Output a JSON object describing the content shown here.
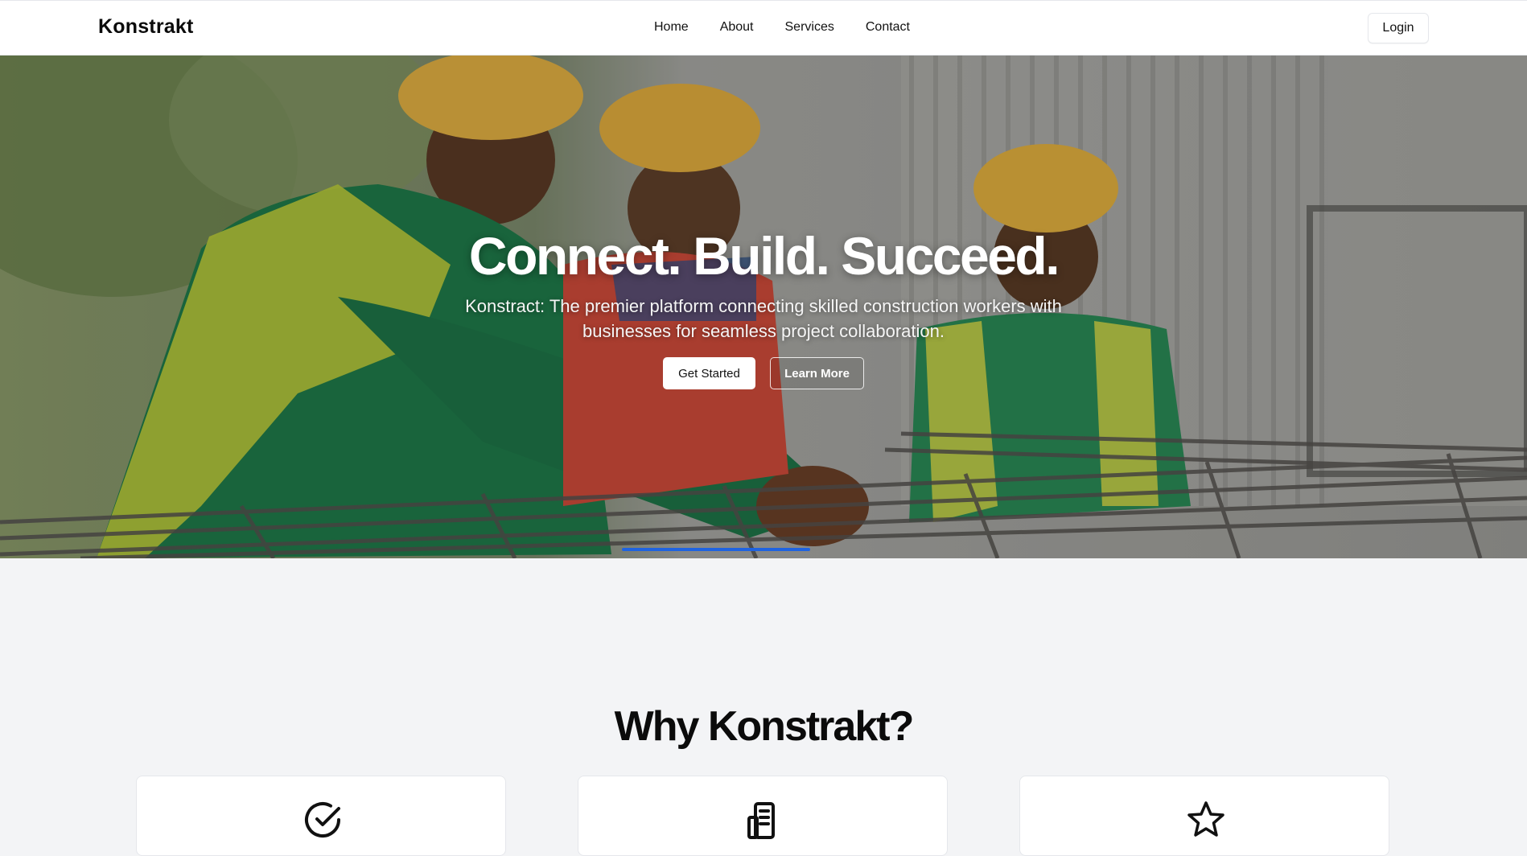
{
  "header": {
    "brand": "Konstrakt",
    "nav": [
      "Home",
      "About",
      "Services",
      "Contact"
    ],
    "login_label": "Login"
  },
  "hero": {
    "title": "Connect. Build. Succeed.",
    "subtitle": "Konstract: The premier platform connecting skilled construction workers with businesses for seamless project collaboration.",
    "primary_cta": "Get Started",
    "secondary_cta": "Learn More"
  },
  "why": {
    "title": "Why Konstrakt?",
    "cards": [
      {
        "icon": "check-circle-icon"
      },
      {
        "icon": "building-icon"
      },
      {
        "icon": "star-icon"
      }
    ]
  },
  "colors": {
    "accent": "#1f63e0",
    "background": "#f3f4f6",
    "navbar": "#ffffff"
  }
}
